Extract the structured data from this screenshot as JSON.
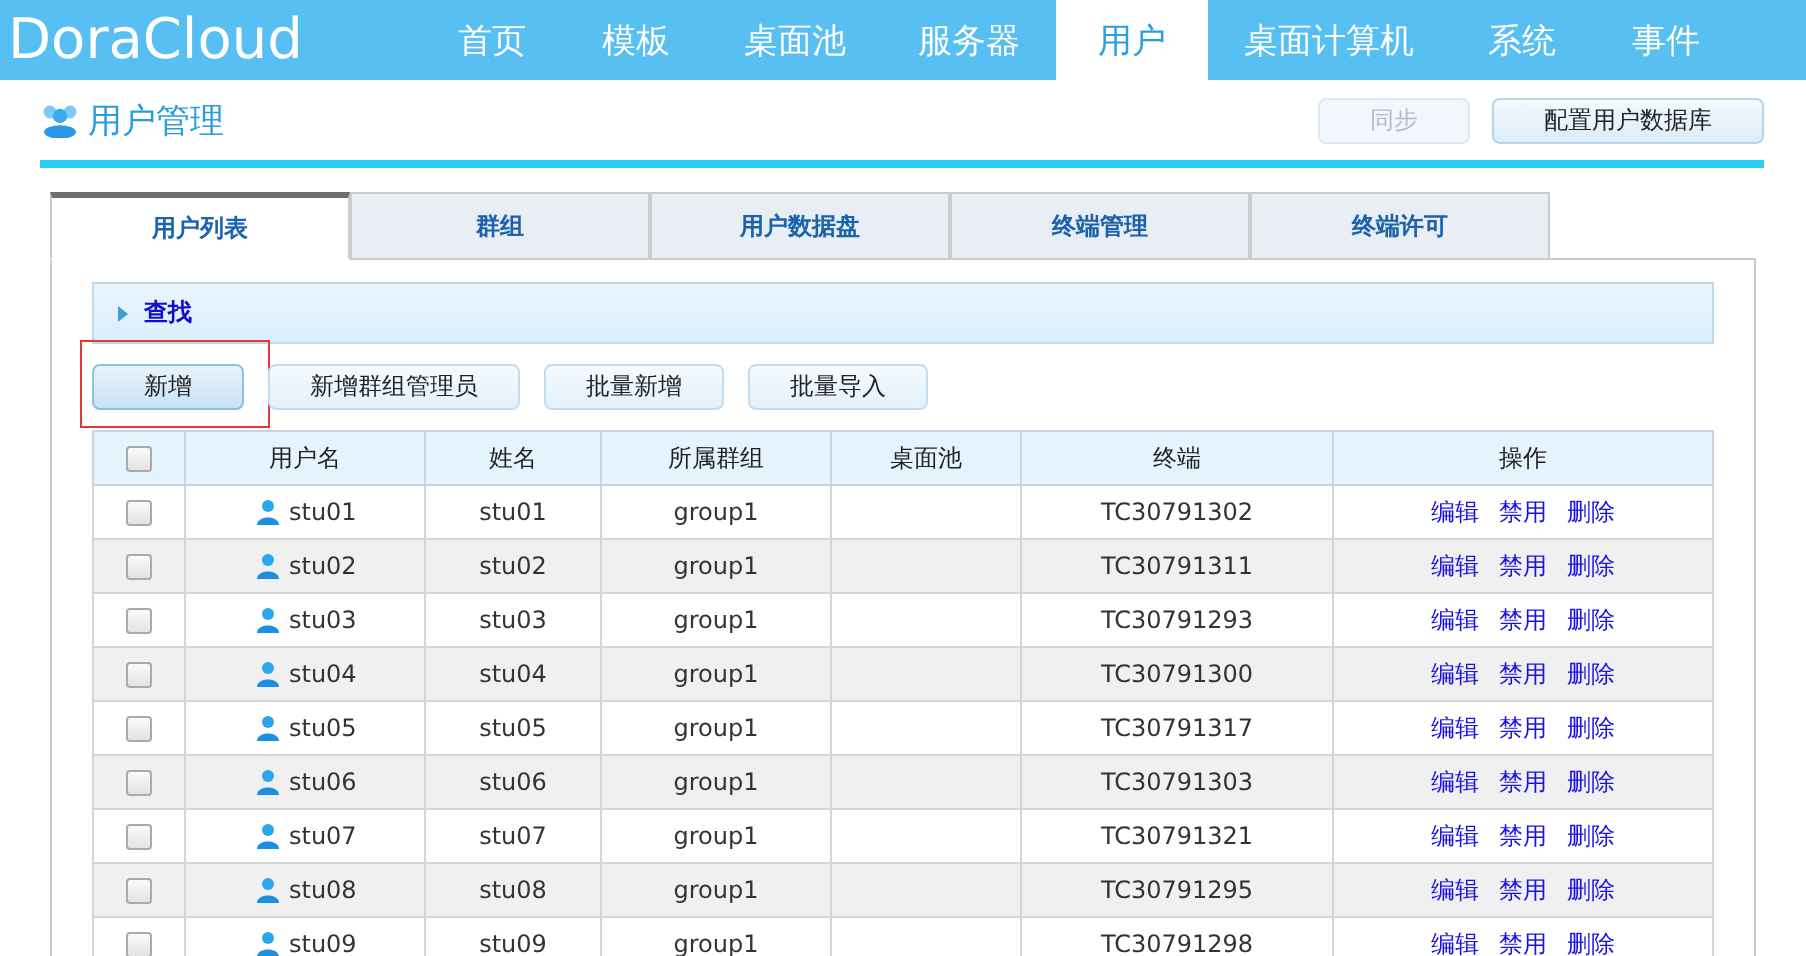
{
  "logo": "DoraCloud",
  "nav": [
    {
      "label": "首页",
      "selected": false
    },
    {
      "label": "模板",
      "selected": false
    },
    {
      "label": "桌面池",
      "selected": false
    },
    {
      "label": "服务器",
      "selected": false
    },
    {
      "label": "用户",
      "selected": true
    },
    {
      "label": "桌面计算机",
      "selected": false
    },
    {
      "label": "系统",
      "selected": false
    },
    {
      "label": "事件",
      "selected": false
    }
  ],
  "page_title": "用户管理",
  "header_buttons": [
    {
      "label": "同步",
      "disabled": true
    },
    {
      "label": "配置用户数据库",
      "disabled": false
    }
  ],
  "tabs": [
    {
      "label": "用户列表",
      "selected": true
    },
    {
      "label": "群组",
      "selected": false
    },
    {
      "label": "用户数据盘",
      "selected": false
    },
    {
      "label": "终端管理",
      "selected": false
    },
    {
      "label": "终端许可",
      "selected": false
    }
  ],
  "search": {
    "label": "查找",
    "expanded": false
  },
  "actions": [
    {
      "label": "新增",
      "highlighted": true
    },
    {
      "label": "新增群组管理员",
      "highlighted": false
    },
    {
      "label": "批量新增",
      "highlighted": false
    },
    {
      "label": "批量导入",
      "highlighted": false
    }
  ],
  "table": {
    "select_all": false,
    "columns": [
      "用户名",
      "姓名",
      "所属群组",
      "桌面池",
      "终端",
      "操作"
    ],
    "rows": [
      {
        "checked": false,
        "username": "stu01",
        "name": "stu01",
        "group": "group1",
        "terminal": "TC30791302",
        "ops": [
          "编辑",
          "禁用",
          "删除"
        ]
      },
      {
        "checked": false,
        "username": "stu02",
        "name": "stu02",
        "group": "group1",
        "terminal": "TC30791311",
        "ops": [
          "编辑",
          "禁用",
          "删除"
        ]
      },
      {
        "checked": false,
        "username": "stu03",
        "name": "stu03",
        "group": "group1",
        "terminal": "TC30791293",
        "ops": [
          "编辑",
          "禁用",
          "删除"
        ]
      },
      {
        "checked": false,
        "username": "stu04",
        "name": "stu04",
        "group": "group1",
        "terminal": "TC30791300",
        "ops": [
          "编辑",
          "禁用",
          "删除"
        ]
      },
      {
        "checked": false,
        "username": "stu05",
        "name": "stu05",
        "group": "group1",
        "terminal": "TC30791317",
        "ops": [
          "编辑",
          "禁用",
          "删除"
        ]
      },
      {
        "checked": false,
        "username": "stu06",
        "name": "stu06",
        "group": "group1",
        "terminal": "TC30791303",
        "ops": [
          "编辑",
          "禁用",
          "删除"
        ]
      },
      {
        "checked": false,
        "username": "stu07",
        "name": "stu07",
        "group": "group1",
        "terminal": "TC30791321",
        "ops": [
          "编辑",
          "禁用",
          "删除"
        ]
      },
      {
        "checked": false,
        "username": "stu08",
        "name": "stu08",
        "group": "group1",
        "terminal": "TC30791295",
        "ops": [
          "编辑",
          "禁用",
          "删除"
        ]
      },
      {
        "checked": false,
        "username": "stu09",
        "name": "stu09",
        "group": "group1",
        "terminal": "TC30791298",
        "ops": [
          "编辑",
          "禁用",
          "删除"
        ]
      }
    ]
  }
}
